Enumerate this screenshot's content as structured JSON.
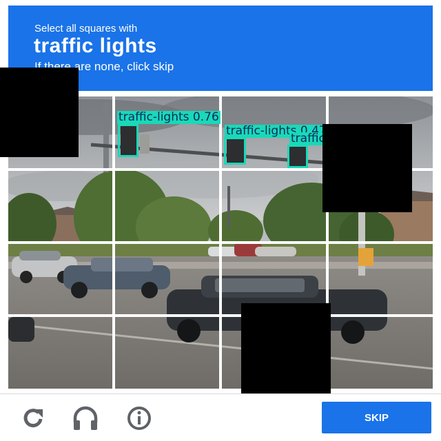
{
  "header": {
    "intro": "Select all squares with",
    "target": "traffic lights",
    "hint": "If there are none, click skip"
  },
  "grid": {
    "rows": 4,
    "cols": 4
  },
  "detections": [
    {
      "label": "traffic-lights 0.76"
    },
    {
      "label": "traffic-lights 0.47"
    },
    {
      "label": "traffic-lights 0.88"
    }
  ],
  "footer": {
    "reload_icon": "reload-icon",
    "audio_icon": "headphones-icon",
    "info_icon": "info-icon",
    "skip_label": "SKIP"
  },
  "colors": {
    "brand_blue": "#1a73e8",
    "detection_box": "#19d9b8",
    "icon_gray": "#5f6368"
  }
}
